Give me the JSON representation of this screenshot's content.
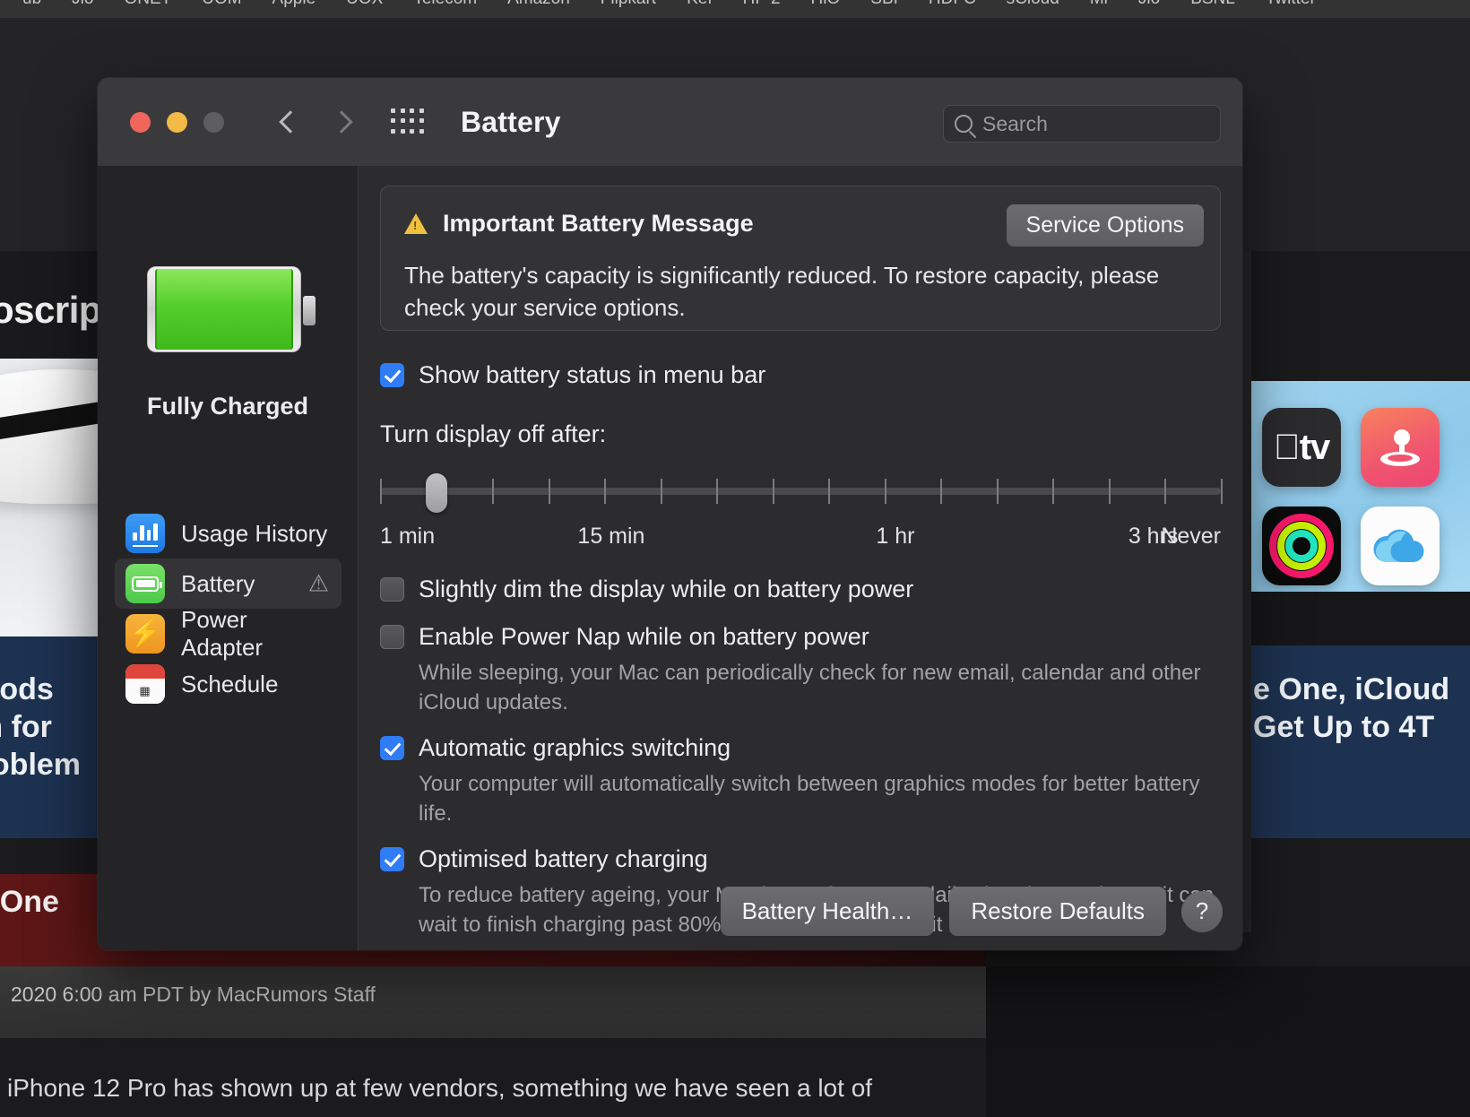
{
  "browser": {
    "bookmarks": [
      "ub",
      "Jio",
      "ONET",
      "UOM",
      "Apple",
      "UOX",
      "Telecom",
      "Amazon",
      "Flipkart",
      "Kef",
      "HP 2",
      "HiO",
      "SBI",
      "HDFC",
      "sCloud",
      "Mi",
      "Jio",
      "BSNL",
      "Twitter"
    ],
    "headline": "oscrip",
    "navy_card_text": "irPods\nam for\nProblem",
    "maroon_card_text": "le One\ns",
    "byline": "2020 6:00 am PDT by MacRumors Staff",
    "bottom_text": "iPhone 12 Pro has shown up at few vendors, something we have seen a lot of",
    "right_navy_text": "e One, iCloud\nGet Up to 4T",
    "app_icons": [
      {
        "name": "apple-tv-icon",
        "glyph": "tv"
      },
      {
        "name": "apple-arcade-icon",
        "glyph": ""
      },
      {
        "name": "apple-fitness-icon",
        "glyph": ""
      },
      {
        "name": "icloud-icon",
        "glyph": ""
      }
    ]
  },
  "window": {
    "title": "Battery",
    "traffic_lights": [
      "close",
      "minimize",
      "zoom"
    ],
    "back_label": "Back",
    "forward_label": "Forward",
    "show_all_label": "Show All",
    "search": {
      "value": "",
      "placeholder": "Search"
    }
  },
  "sidebar": {
    "battery_status": "Fully Charged",
    "items": [
      {
        "label": "Usage History",
        "icon": "usage-history-icon",
        "active": false,
        "warning": false
      },
      {
        "label": "Battery",
        "icon": "battery-icon",
        "active": true,
        "warning": true
      },
      {
        "label": "Power Adapter",
        "icon": "power-adapter-icon",
        "active": false,
        "warning": false
      },
      {
        "label": "Schedule",
        "icon": "schedule-icon",
        "active": false,
        "warning": false
      }
    ]
  },
  "main": {
    "alert": {
      "title": "Important Battery Message",
      "body": "The battery's capacity is significantly reduced. To restore capacity, please check your service options.",
      "button": "Service Options"
    },
    "show_status": {
      "label": "Show battery status in menu bar",
      "checked": true
    },
    "slider": {
      "label": "Turn display off after:",
      "tick_labels": [
        "1 min",
        "15 min",
        "1 hr",
        "3 hrs",
        "Never"
      ],
      "tick_count": 16,
      "value_index": 1
    },
    "options": [
      {
        "label": "Slightly dim the display while on battery power",
        "checked": false,
        "sub": ""
      },
      {
        "label": "Enable Power Nap while on battery power",
        "checked": false,
        "sub": "While sleeping, your Mac can periodically check for new email, calendar and other iCloud updates."
      },
      {
        "label": "Automatic graphics switching",
        "checked": true,
        "sub": "Your computer will automatically switch between graphics modes for better battery life."
      },
      {
        "label": "Optimised battery charging",
        "checked": true,
        "sub": "To reduce battery ageing, your Mac learns from your daily charging routine so it can wait to finish charging past 80% until you need to use it on battery."
      }
    ],
    "footer": {
      "battery_health": "Battery Health…",
      "restore_defaults": "Restore Defaults",
      "help": "?"
    }
  },
  "colors": {
    "accent": "#2f7cf6",
    "warning": "#f0c040",
    "battery_green": "#55cf2b",
    "window_bg": "#2c2c2e",
    "titlebar_bg": "#3a3a3c"
  }
}
